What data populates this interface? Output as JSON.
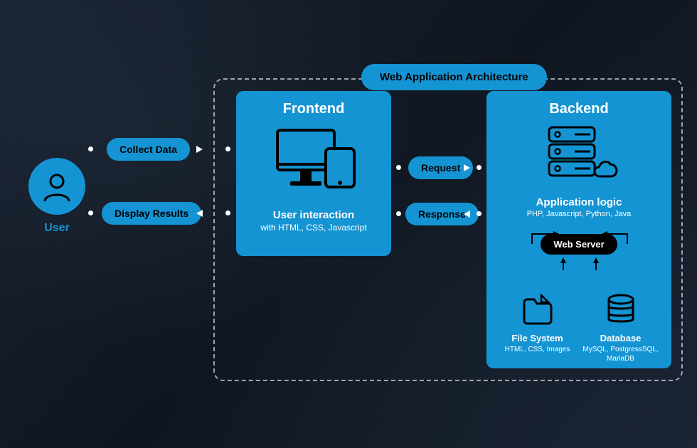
{
  "title": "Web Application Architecture",
  "user": {
    "label": "User"
  },
  "pills": {
    "collect": "Collect Data",
    "display": "Display Results",
    "request": "Request",
    "response": "Response"
  },
  "frontend": {
    "heading": "Frontend",
    "sub1": "User interaction",
    "sub2": "with HTML, CSS, Javascript"
  },
  "backend": {
    "heading": "Backend",
    "app_logic": "Application logic",
    "app_tech": "PHP, Javascript, Python, Java",
    "webserver": "Web Server",
    "filesystem": {
      "label": "File System",
      "tech": "HTML, CSS, Images"
    },
    "database": {
      "label": "Database",
      "tech": "MySQL, PostgressSQL, MariaDB"
    }
  },
  "colors": {
    "accent": "#1594d3",
    "bg": "#141d29"
  }
}
